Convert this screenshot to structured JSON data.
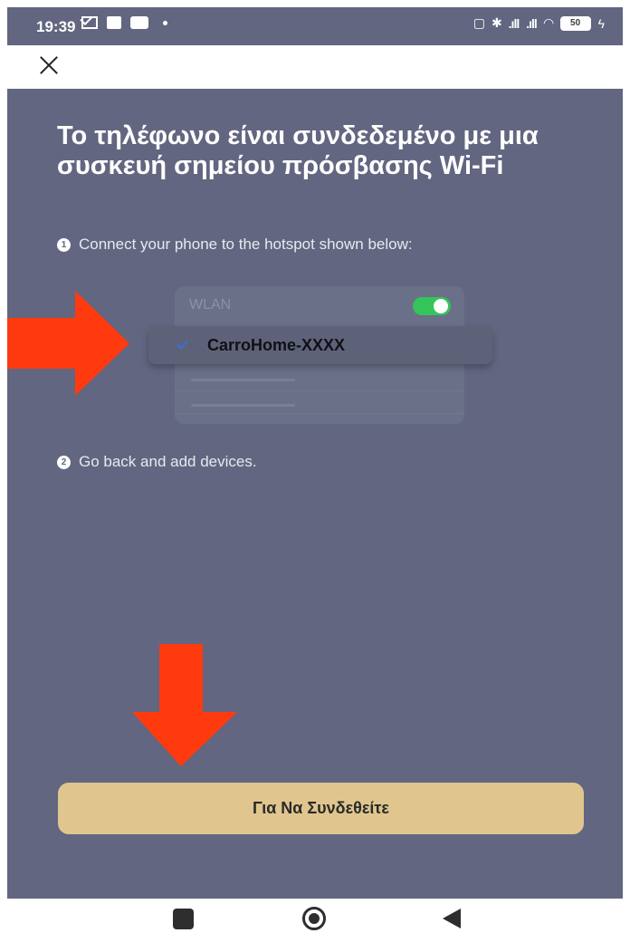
{
  "status_bar": {
    "time": "19:39",
    "battery_level": "50"
  },
  "toolbar": {
    "close_icon": "close-icon"
  },
  "main": {
    "headline": "Το τηλέφωνο είναι συνδεδεμένο με μια συσκευή σημείου πρόσβασης Wi-Fi",
    "step1": {
      "number": "1",
      "text": "Connect your phone to the hotspot shown below:"
    },
    "illustration": {
      "wlan_label": "WLAN",
      "network_name": "CarroHome-XXXX",
      "toggle_on": true
    },
    "step2": {
      "number": "2",
      "text": "Go back and add devices."
    },
    "connect_button": "Για Να Συνδεθείτε"
  },
  "colors": {
    "background": "#626680",
    "button": "#e0c68e",
    "arrow": "#ff3a0f",
    "toggle": "#33c55a"
  }
}
